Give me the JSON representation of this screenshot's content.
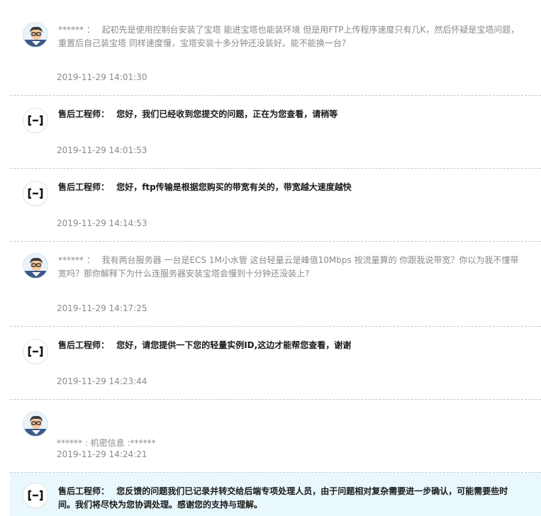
{
  "messages": [
    {
      "role": "user",
      "name": "****** ：",
      "text": "起初先是使用控制台安装了宝塔 能进宝塔也能装环境 但是用FTP上传程序速度只有几K，然后怀疑是宝塔问题，重置后自己装宝塔 同样速度慢，宝塔安装十多分钟还没装好。能不能换一台？",
      "time": "2019-11-29 14:01:30"
    },
    {
      "role": "engineer",
      "name": "售后工程师：",
      "text": "您好，我们已经收到您提交的问题，正在为您查看，请稍等",
      "time": "2019-11-29 14:01:53"
    },
    {
      "role": "engineer",
      "name": "售后工程师：",
      "text": "您好，ftp传输是根据您购买的带宽有关的，带宽越大速度越快",
      "time": "2019-11-29 14:14:53"
    },
    {
      "role": "user",
      "name": "****** ：",
      "text": "我有两台服务器 一台是ECS 1M小水管 这台轻量云是峰值10Mbps 按流量算的 你跟我说带宽？你以为我不懂带宽吗？那你解释下为什么连服务器安装宝塔会慢到十分钟还没装上?",
      "time": "2019-11-29 14:17:25"
    },
    {
      "role": "engineer",
      "name": "售后工程师：",
      "text": "您好，请您提供一下您的轻量实例ID,这边才能帮您查看，谢谢",
      "time": "2019-11-29 14:23:44"
    },
    {
      "role": "user",
      "name": "",
      "text": "",
      "secret": "****** : 机密信息 :******",
      "time": "2019-11-29 14:24:21"
    },
    {
      "role": "engineer",
      "name": "售后工程师：",
      "text": "您反馈的问题我们已记录并转交给后端专项处理人员，由于问题相对复杂需要进一步确认，可能需要些时间。我们将尽快为您协调处理。感谢您的支持与理解。",
      "time": ""
    }
  ]
}
